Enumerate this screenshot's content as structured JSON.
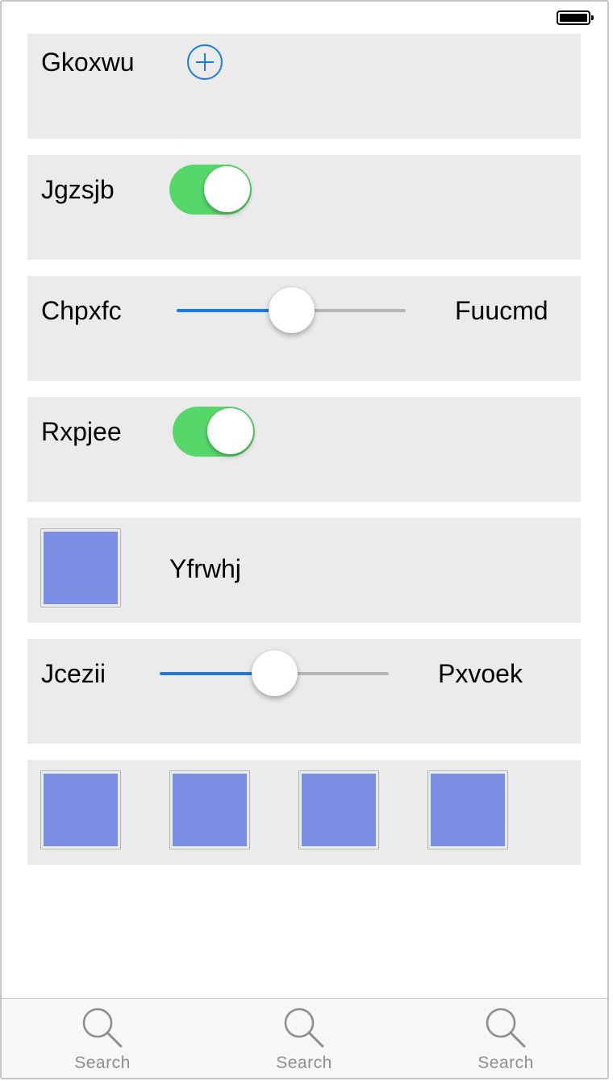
{
  "status_bar": {
    "battery_icon": "battery-full-icon"
  },
  "accent_color": "#1a7ce8",
  "toggle_on_color": "#55d769",
  "thumbnail_color": "#7a8fe4",
  "rows": {
    "row1": {
      "label": "Gkoxwu",
      "control": "add-circle-icon"
    },
    "row2": {
      "label": "Jgzsjb",
      "toggle_on": true
    },
    "row3": {
      "label": "Chpxfc",
      "value_label": "Fuucmd",
      "slider_value": 0.5
    },
    "row4": {
      "label": "Rxpjee",
      "toggle_on": true
    },
    "row5": {
      "label": "Yfrwhj",
      "thumbnail": "image-thumbnail"
    },
    "row6": {
      "label": "Jcezii",
      "value_label": "Pxvoek",
      "slider_value": 0.5
    },
    "row7": {
      "thumbnails": 4
    }
  },
  "tabbar": {
    "tabs": [
      {
        "label": "Search",
        "icon": "search-icon"
      },
      {
        "label": "Search",
        "icon": "search-icon"
      },
      {
        "label": "Search",
        "icon": "search-icon"
      }
    ]
  }
}
